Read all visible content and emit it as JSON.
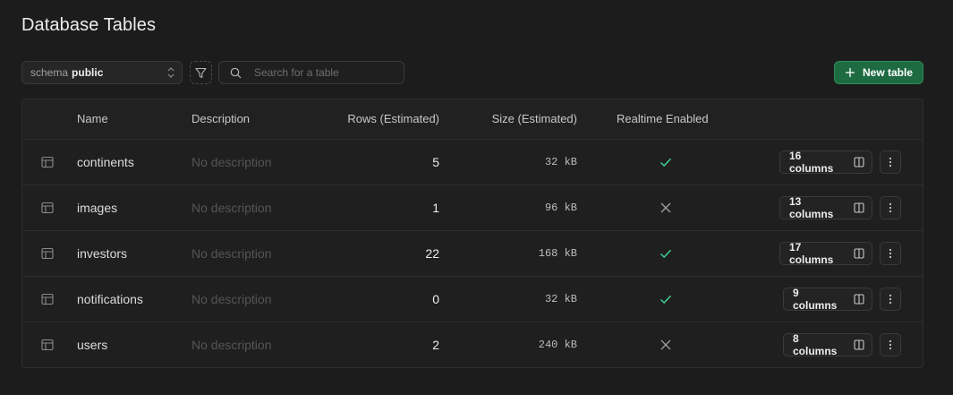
{
  "page": {
    "title": "Database Tables"
  },
  "toolbar": {
    "schema_label": "schema",
    "schema_value": "public",
    "search_placeholder": "Search for a table",
    "new_table_label": "New table"
  },
  "table": {
    "headers": {
      "name": "Name",
      "description": "Description",
      "rows": "Rows (Estimated)",
      "size": "Size (Estimated)",
      "realtime": "Realtime Enabled"
    },
    "rows": [
      {
        "name": "continents",
        "description": "No description",
        "rows": "5",
        "size": "32 kB",
        "realtime": true,
        "columns": "16 columns"
      },
      {
        "name": "images",
        "description": "No description",
        "rows": "1",
        "size": "96 kB",
        "realtime": false,
        "columns": "13 columns"
      },
      {
        "name": "investors",
        "description": "No description",
        "rows": "22",
        "size": "168 kB",
        "realtime": true,
        "columns": "17 columns"
      },
      {
        "name": "notifications",
        "description": "No description",
        "rows": "0",
        "size": "32 kB",
        "realtime": true,
        "columns": "9 columns"
      },
      {
        "name": "users",
        "description": "No description",
        "rows": "2",
        "size": "240 kB",
        "realtime": false,
        "columns": "8 columns"
      }
    ]
  },
  "colors": {
    "accent_green": "#3ecf8e",
    "button_green": "#1e6b42",
    "x_gray": "#a0a0a0"
  },
  "icons": {
    "filter": "filter-icon",
    "search": "search-icon",
    "plus": "plus-icon",
    "table": "table-icon",
    "check": "check-icon",
    "cross": "close-icon",
    "columns": "columns-icon",
    "more": "more-vertical-icon"
  }
}
